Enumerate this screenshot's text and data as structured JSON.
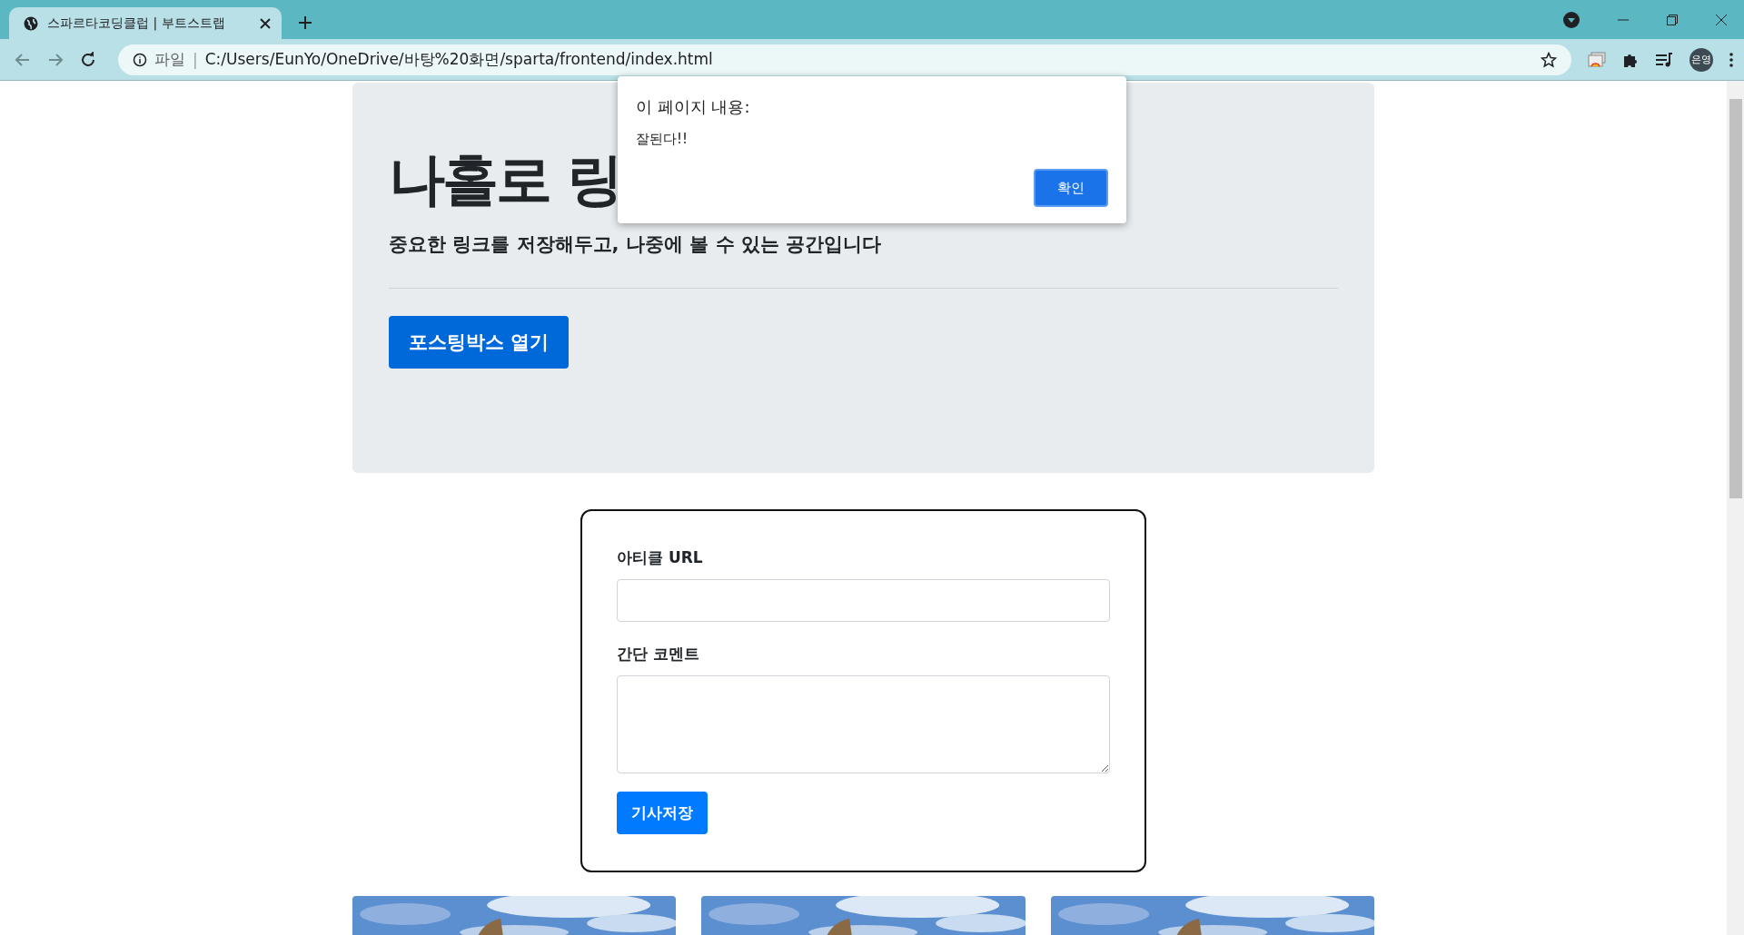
{
  "browser": {
    "tab": {
      "title": "스파르타코딩클럽 | 부트스트랩"
    },
    "address": {
      "scheme_label": "파일",
      "separator": "|",
      "url": "C:/Users/EunYo/OneDrive/바탕%20화면/sparta/frontend/index.html"
    },
    "profile": "은영"
  },
  "hero": {
    "title": "나홀로 링",
    "subtitle": "중요한 링크를 저장해두고, 나중에 볼 수 있는 공간입니다",
    "button": "포스팅박스 열기"
  },
  "form": {
    "url_label": "아티클 URL",
    "comment_label": "간단 코멘트",
    "save_button": "기사저장"
  },
  "dialog": {
    "title": "이 페이지 내용:",
    "message": "잘된다!!",
    "ok_button": "확인"
  }
}
